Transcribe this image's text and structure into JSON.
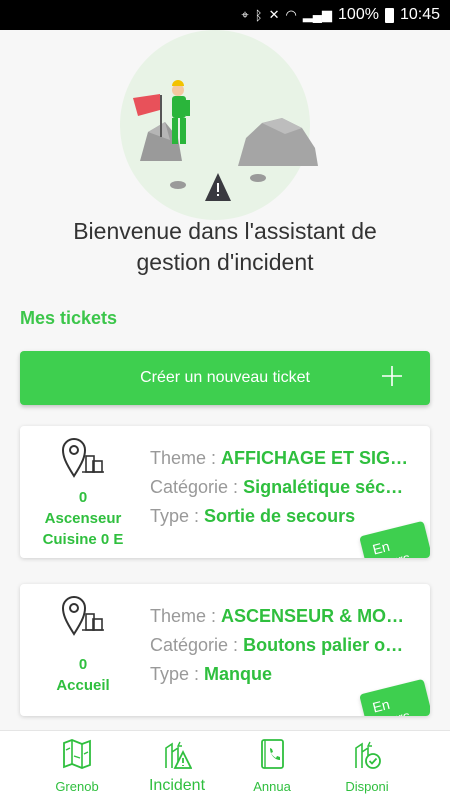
{
  "status_bar": {
    "battery": "100%",
    "time": "10:45"
  },
  "welcome_text": "Bienvenue dans l'assistant de gestion d'incident",
  "section_title": "Mes tickets",
  "create_button": {
    "label": "Créer un nouveau ticket"
  },
  "tickets": [
    {
      "location_line1": "0",
      "location_line2": "Ascenseur",
      "location_line3": "Cuisine 0 E",
      "theme_label": "Theme :",
      "theme_value": "AFFICHAGE ET SIG…",
      "category_label": "Catégorie :",
      "category_value": "Signalétique séc…",
      "type_label": "Type :",
      "type_value": "Sortie de secours",
      "status": "En cours"
    },
    {
      "location_line1": "0",
      "location_line2": "Accueil",
      "theme_label": "Theme :",
      "theme_value": "ASCENSEUR & MO…",
      "category_label": "Catégorie :",
      "category_value": "Boutons palier o…",
      "type_label": "Type :",
      "type_value": "Manque",
      "status": "En cours"
    }
  ],
  "bottom_nav": [
    {
      "label": "Grenob",
      "icon": "map-icon"
    },
    {
      "label": "Incident",
      "icon": "incident-icon",
      "active": true
    },
    {
      "label": "Annua",
      "icon": "directory-icon"
    },
    {
      "label": "Disponi",
      "icon": "availability-icon"
    }
  ],
  "colors": {
    "accent": "#3ecf4f",
    "accent_text": "#2fbf3e"
  }
}
